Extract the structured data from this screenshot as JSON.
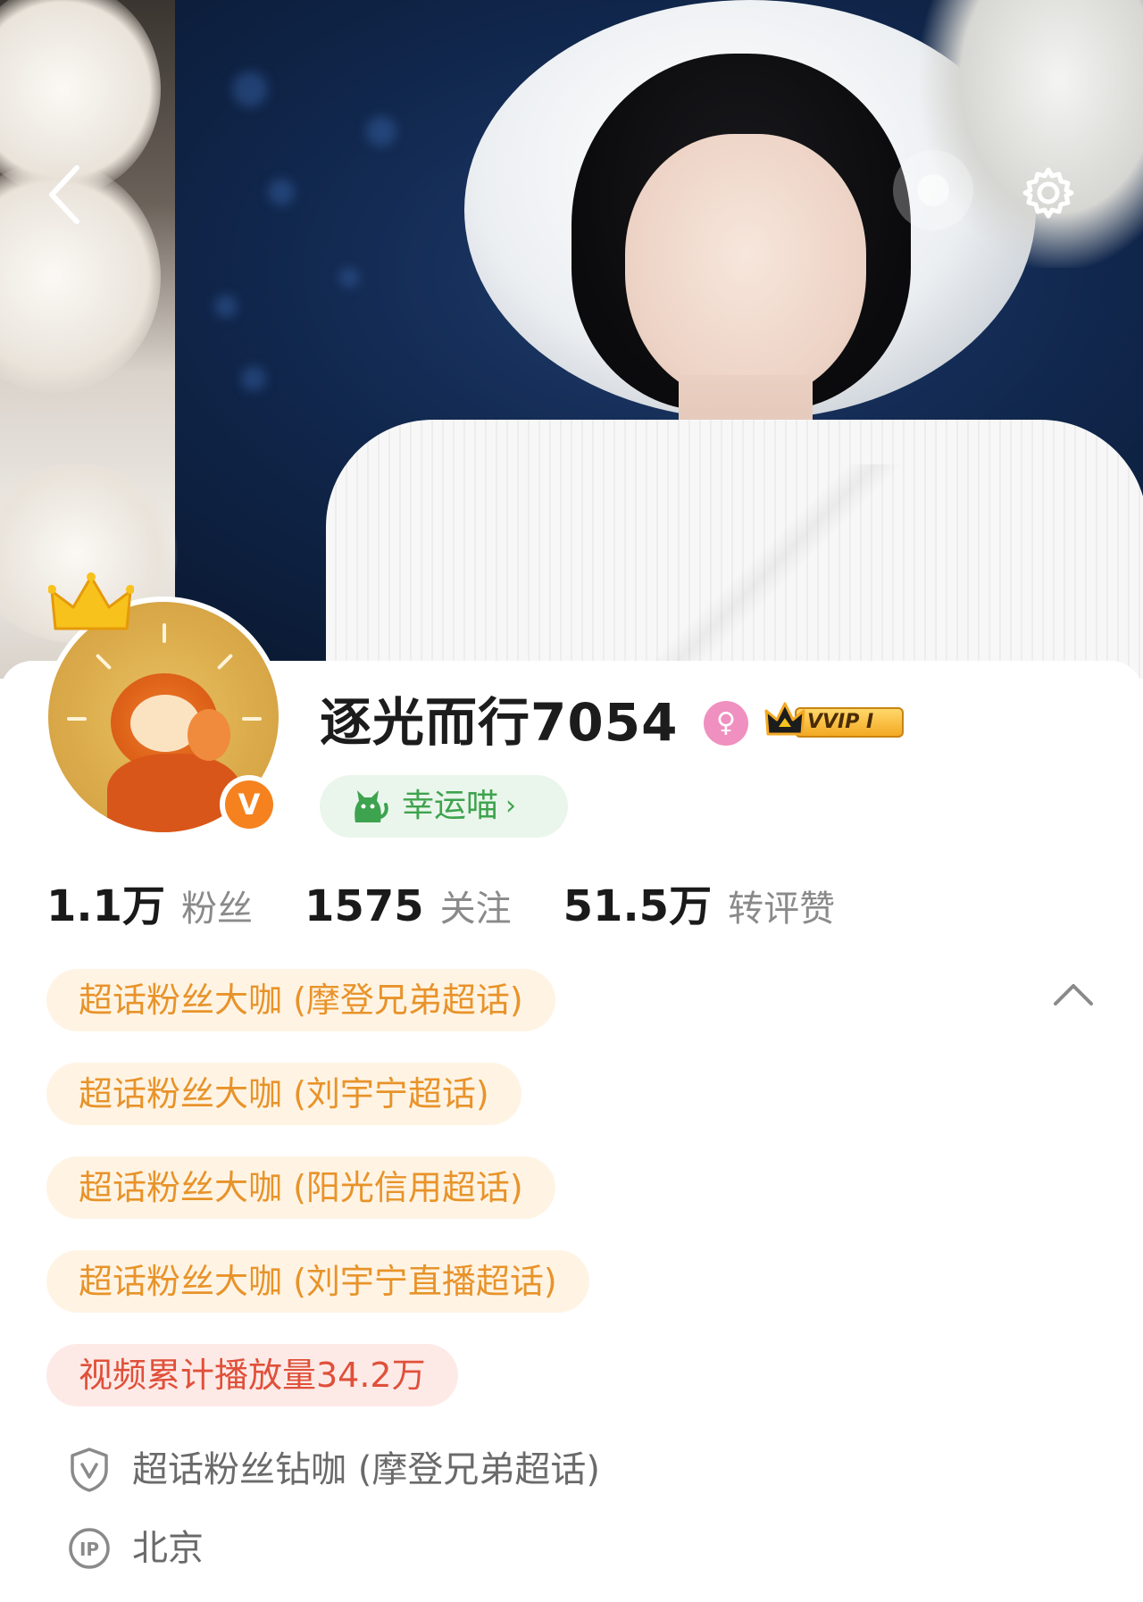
{
  "nav": {
    "back_icon": "chevron-left-icon",
    "action_icon": "circle-icon",
    "settings_icon": "gear-icon"
  },
  "profile": {
    "username": "逐光而行7054",
    "gender_icon": "female-icon",
    "vip_label": "VVIP I",
    "lucky_badge": "幸运喵",
    "lucky_chevron": "›"
  },
  "stats": [
    {
      "value": "1.1万",
      "label": "粉丝"
    },
    {
      "value": "1575",
      "label": "关注"
    },
    {
      "value": "51.5万",
      "label": "转评赞"
    }
  ],
  "tags": [
    {
      "label": "超话粉丝大咖 (摩登兄弟超话)"
    },
    {
      "label": "超话粉丝大咖 (刘宇宁超话)"
    },
    {
      "label": "超话粉丝大咖 (阳光信用超话)"
    },
    {
      "label": "超话粉丝大咖 (刘宇宁直播超话)"
    },
    {
      "label": "视频累计播放量34.2万"
    }
  ],
  "info": [
    {
      "icon": "shield-v-icon",
      "text": "超话粉丝钻咖 (摩登兄弟超话)"
    },
    {
      "icon": "ip-icon",
      "text": "北京"
    }
  ],
  "colors": {
    "accent_orange": "#e8932a",
    "tag_bg": "#fff4e4",
    "red_tag_text": "#e0503a",
    "lucky_green": "#3ea34e",
    "verify_orange": "#f5821f"
  }
}
